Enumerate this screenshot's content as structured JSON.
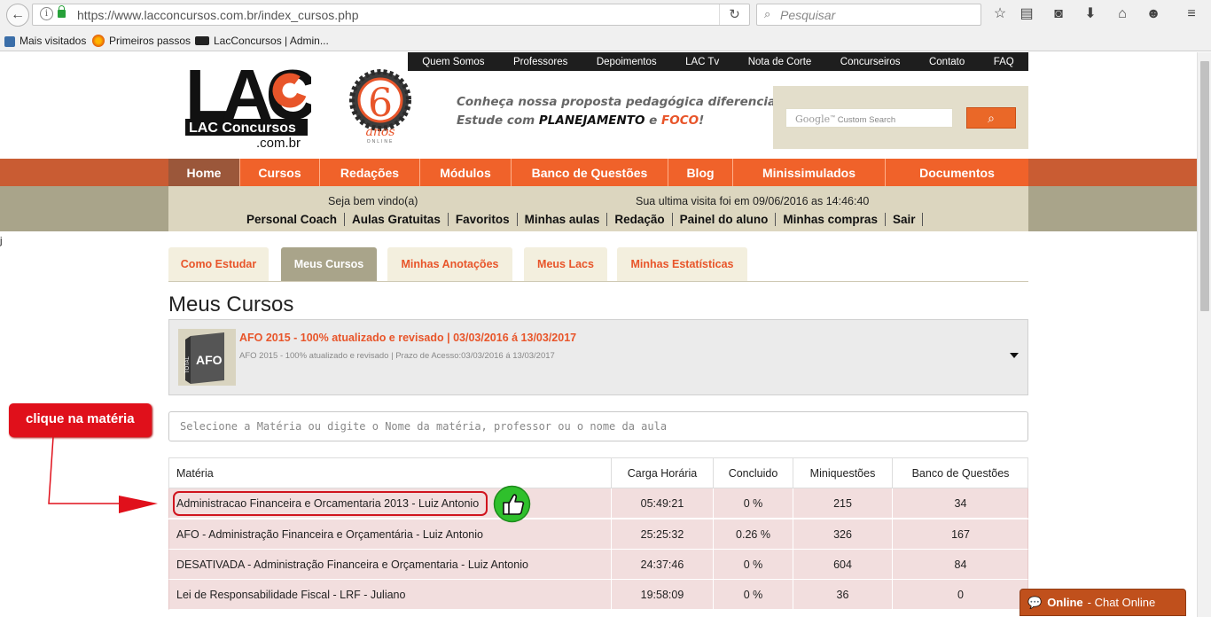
{
  "browser": {
    "url": "https://www.lacconcursos.com.br/index_cursos.php",
    "search_placeholder": "Pesquisar",
    "bookmarks": [
      "Mais visitados",
      "Primeiros passos",
      "LacConcursos | Admin..."
    ]
  },
  "top_nav": [
    "Quem Somos",
    "Professores",
    "Depoimentos",
    "LAC Tv",
    "Nota de Corte",
    "Concurseiros",
    "Contato",
    "FAQ"
  ],
  "logo": {
    "main": "LAC",
    "line1": "LAC Concursos",
    "line2": ".com.br",
    "brand_color": "#e8552a"
  },
  "badge": {
    "number": "6",
    "word": "anos",
    "small": "ONLINE"
  },
  "slogan": {
    "line1": "Conheça nossa proposta pedagógica diferenciada.",
    "line2_prefix": "Estude com ",
    "line2_b1": "PLANEJAMENTO",
    "line2_mid": " e ",
    "line2_b2": "FOCO",
    "line2_end": "!"
  },
  "gsearch": {
    "google": "Google",
    "tm": "™",
    "label": " Custom Search"
  },
  "main_menu": [
    "Home",
    "Cursos",
    "Redações",
    "Módulos",
    "Banco de Questões",
    "Blog",
    "Minissimulados",
    "Documentos"
  ],
  "subbar": {
    "welcome": "Seja bem vindo(a)",
    "last_visit": "Sua ultima visita foi em 09/06/2016 as 14:46:40",
    "links": [
      "Personal Coach",
      "Aulas Gratuitas",
      "Favoritos",
      "Minhas aulas",
      "Redação",
      "Painel do aluno",
      "Minhas compras",
      "Sair"
    ]
  },
  "stray_char": "j",
  "tabs": [
    "Como Estudar",
    "Meus Cursos",
    "Minhas Anotações",
    "Meus Lacs",
    "Minhas Estatísticas"
  ],
  "heading": "Meus Cursos",
  "course": {
    "title": "AFO 2015 - 100% atualizado e revisado | 03/03/2016 á 13/03/2017",
    "subtitle": "AFO 2015 - 100% atualizado e revisado | Prazo de Acesso:03/03/2016 á 13/03/2017",
    "book_top": "TOTAL",
    "book_title": "AFO"
  },
  "callout": "clique  na matéria",
  "filter_placeholder": "Selecione a Matéria ou digite o Nome da matéria, professor ou o nome da aula",
  "table": {
    "headers": [
      "Matéria",
      "Carga Horária",
      "Concluido",
      "Miniquestões",
      "Banco de Questões"
    ],
    "rows": [
      [
        "Administracao Financeira e Orcamentaria 2013 - Luiz Antonio",
        "05:49:21",
        "0 %",
        "215",
        "34"
      ],
      [
        "AFO - Administração Financeira e Orçamentária - Luiz Antonio",
        "25:25:32",
        "0.26 %",
        "326",
        "167"
      ],
      [
        "DESATIVADA - Administração Financeira e Orçamentaria - Luiz Antonio",
        "24:37:46",
        "0 %",
        "604",
        "84"
      ],
      [
        "Lei de Responsabilidade Fiscal - LRF - Juliano",
        "19:58:09",
        "0 %",
        "36",
        "0"
      ]
    ]
  },
  "chat": {
    "status": "Online",
    "label": "- Chat Online"
  }
}
